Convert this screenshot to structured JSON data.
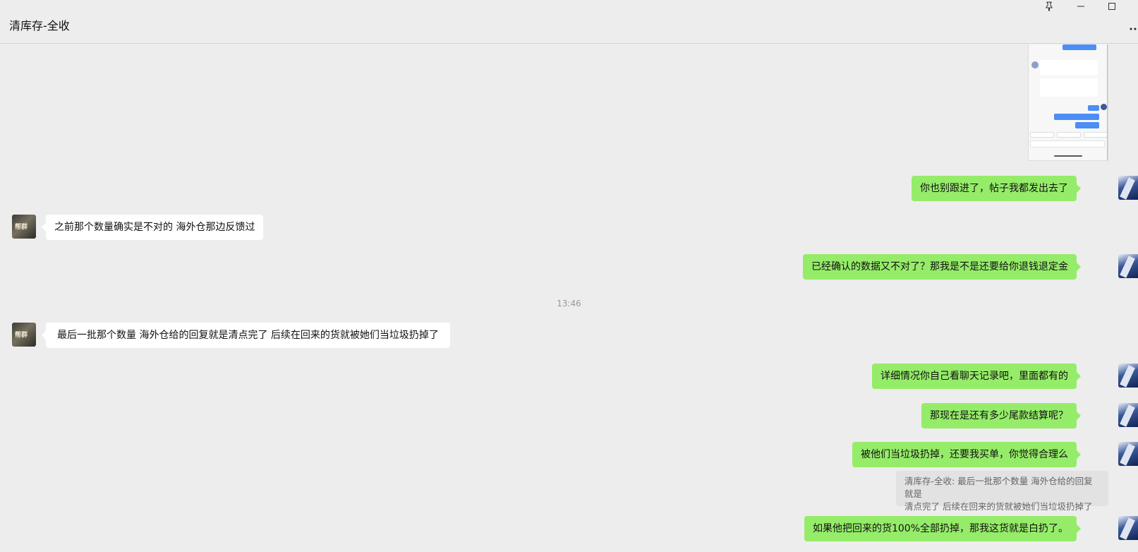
{
  "window": {
    "title": "清库存-全收"
  },
  "timestamp": "13:46",
  "messages": [
    {
      "side": "right",
      "text": "你也别跟进了，帖子我都发出去了"
    },
    {
      "side": "left",
      "text": "之前那个数量确实是不对的 海外仓那边反馈过"
    },
    {
      "side": "right",
      "text": "已经确认的数据又不对了？那我是不是还要给你退钱退定金"
    },
    {
      "side": "left",
      "text": "最后一批那个数量 海外仓给的回复就是清点完了 后续在回来的货就被她们当垃圾扔掉了"
    },
    {
      "side": "right",
      "text": "详细情况你自己看聊天记录吧，里面都有的"
    },
    {
      "side": "right",
      "text": "那现在是还有多少尾款结算呢？"
    },
    {
      "side": "right",
      "text": "被他们当垃圾扔掉，还要我买单，你觉得合理么"
    },
    {
      "side": "right",
      "text": "如果他把回来的货100%全部扔掉，那我这货就是白扔了。"
    }
  ],
  "quote": {
    "line1": "清库存-全收: 最后一批那个数量 海外仓给的回复就是",
    "line2": "清点完了 后续在回来的货就被她们当垃圾扔掉了"
  },
  "colors": {
    "own_bubble": "#95ec69",
    "other_bubble": "#ffffff",
    "background": "#ededed"
  },
  "icons": [
    "pin-icon",
    "minimize-icon",
    "maximize-icon",
    "more-icon"
  ]
}
